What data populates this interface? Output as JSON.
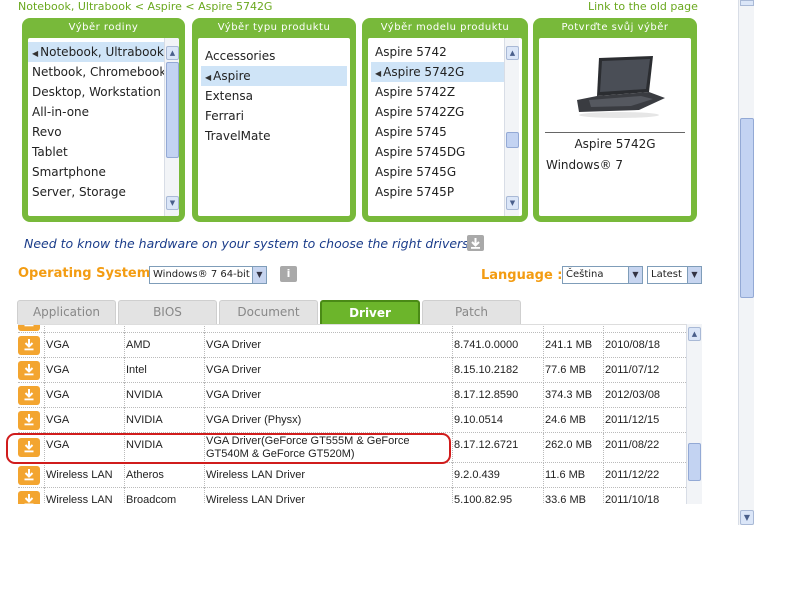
{
  "breadcrumb": {
    "text": "Notebook, Ultrabook < Aspire < Aspire 5742G",
    "old_page_link": "Link to the old page"
  },
  "panels": {
    "family": {
      "title": "Výběr rodiny",
      "items": [
        "Notebook, Ultrabook",
        "Netbook, Chromebook",
        "Desktop, Workstation",
        "All-in-one",
        "Revo",
        "Tablet",
        "Smartphone",
        "Server, Storage"
      ],
      "selected": "Notebook, Ultrabook"
    },
    "type": {
      "title": "Výběr typu produktu",
      "items": [
        "Accessories",
        "Aspire",
        "Extensa",
        "Ferrari",
        "TravelMate"
      ],
      "selected": "Aspire"
    },
    "model": {
      "title": "Výběr modelu produktu",
      "items": [
        "Aspire 5742",
        "Aspire 5742G",
        "Aspire 5742Z",
        "Aspire 5742ZG",
        "Aspire 5745",
        "Aspire 5745DG",
        "Aspire 5745G",
        "Aspire 5745P"
      ],
      "selected": "Aspire 5742G"
    },
    "confirm": {
      "title": "Potvrďte svůj výběr",
      "product": "Aspire 5742G",
      "os": "Windows® 7"
    }
  },
  "hardware_question": "Need to know the hardware on your system to choose the right drivers?",
  "os_label": "Operating System :",
  "os_value": "Windows® 7 64-bit",
  "language_label": "Language :",
  "language_value": "Čeština",
  "version_value": "Latest",
  "colors": {
    "accent_green": "#78b93a",
    "orange": "#f39c12",
    "link_blue": "#1a3c8a",
    "highlight_red": "#d01c1c"
  },
  "tabs": [
    "Application",
    "BIOS",
    "Document",
    "Driver",
    "Patch"
  ],
  "active_tab": "Driver",
  "drivers": [
    {
      "category": "VGA",
      "vendor": "AMD",
      "description": "VGA Driver",
      "version": "8.741.0.0000",
      "size": "241.1 MB",
      "date": "2010/08/18"
    },
    {
      "category": "VGA",
      "vendor": "Intel",
      "description": "VGA Driver",
      "version": "8.15.10.2182",
      "size": "77.6 MB",
      "date": "2011/07/12"
    },
    {
      "category": "VGA",
      "vendor": "NVIDIA",
      "description": "VGA Driver",
      "version": "8.17.12.8590",
      "size": "374.3 MB",
      "date": "2012/03/08"
    },
    {
      "category": "VGA",
      "vendor": "NVIDIA",
      "description": "VGA Driver (Physx)",
      "version": "9.10.0514",
      "size": "24.6 MB",
      "date": "2011/12/15"
    },
    {
      "category": "VGA",
      "vendor": "NVIDIA",
      "description": "VGA Driver(GeForce GT555M & GeForce GT540M & GeForce GT520M)",
      "version": "8.17.12.6721",
      "size": "262.0 MB",
      "date": "2011/08/22"
    },
    {
      "category": "Wireless LAN",
      "vendor": "Atheros",
      "description": "Wireless LAN Driver",
      "version": "9.2.0.439",
      "size": "11.6 MB",
      "date": "2011/12/22"
    },
    {
      "category": "Wireless LAN",
      "vendor": "Broadcom",
      "description": "Wireless LAN Driver",
      "version": "5.100.82.95",
      "size": "33.6 MB",
      "date": "2011/10/18"
    }
  ]
}
